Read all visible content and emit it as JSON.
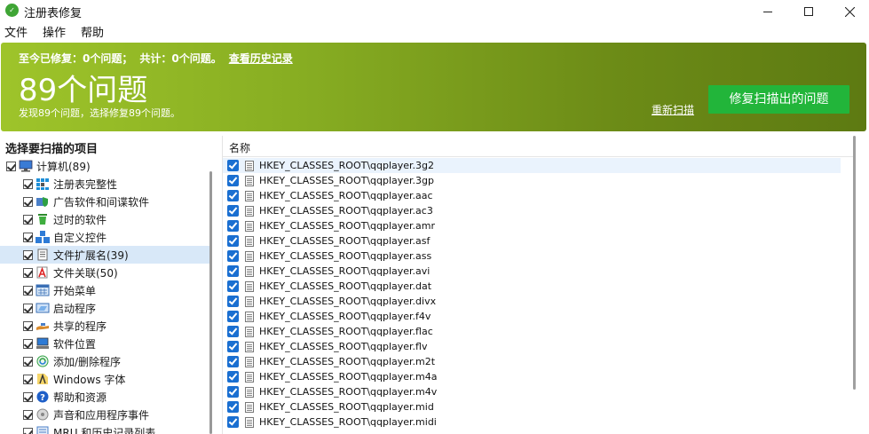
{
  "window": {
    "title": "注册表修复",
    "app_icon": "app-logo-icon"
  },
  "menu": [
    "文件",
    "操作",
    "帮助"
  ],
  "banner": {
    "stats": [
      "至今已修复：0个问题；",
      "共计：0个问题。"
    ],
    "history_link": "查看历史记录",
    "count_title": "89个问题",
    "subtitle": "发现89个问题，选择修复89个问题。",
    "rescan": "重新扫描",
    "fix_button": "修复扫描出的问题",
    "accent_colors": [
      "#9ec42a",
      "#5d7a12"
    ],
    "button_color": "#22b53a"
  },
  "left_panel": {
    "header": "选择要扫描的项目",
    "root": {
      "label": "计算机(89)",
      "icon": "computer-icon"
    },
    "items": [
      {
        "label": "注册表完整性",
        "icon": "registry-icon"
      },
      {
        "label": "广告软件和间谍软件",
        "icon": "shield-icon"
      },
      {
        "label": "过时的软件",
        "icon": "trash-icon"
      },
      {
        "label": "自定义控件",
        "icon": "blocks-icon"
      },
      {
        "label": "文件扩展名(39)",
        "icon": "file-list-icon",
        "selected": true
      },
      {
        "label": "文件关联(50)",
        "icon": "file-a-icon"
      },
      {
        "label": "开始菜单",
        "icon": "menu-grid-icon"
      },
      {
        "label": "启动程序",
        "icon": "window-icon"
      },
      {
        "label": "共享的程序",
        "icon": "share-hand-icon"
      },
      {
        "label": "软件位置",
        "icon": "computer-small-icon"
      },
      {
        "label": "添加/删除程序",
        "icon": "recycle-icon"
      },
      {
        "label": "Windows 字体",
        "icon": "font-icon"
      },
      {
        "label": "帮助和资源",
        "icon": "help-icon"
      },
      {
        "label": "声音和应用程序事件",
        "icon": "sound-icon"
      },
      {
        "label": "MRU 和历史记录列表",
        "icon": "history-icon"
      }
    ]
  },
  "right_panel": {
    "column_header": "名称",
    "rows": [
      "HKEY_CLASSES_ROOT\\qqplayer.3g2",
      "HKEY_CLASSES_ROOT\\qqplayer.3gp",
      "HKEY_CLASSES_ROOT\\qqplayer.aac",
      "HKEY_CLASSES_ROOT\\qqplayer.ac3",
      "HKEY_CLASSES_ROOT\\qqplayer.amr",
      "HKEY_CLASSES_ROOT\\qqplayer.asf",
      "HKEY_CLASSES_ROOT\\qqplayer.ass",
      "HKEY_CLASSES_ROOT\\qqplayer.avi",
      "HKEY_CLASSES_ROOT\\qqplayer.dat",
      "HKEY_CLASSES_ROOT\\qqplayer.divx",
      "HKEY_CLASSES_ROOT\\qqplayer.f4v",
      "HKEY_CLASSES_ROOT\\qqplayer.flac",
      "HKEY_CLASSES_ROOT\\qqplayer.flv",
      "HKEY_CLASSES_ROOT\\qqplayer.m2t",
      "HKEY_CLASSES_ROOT\\qqplayer.m4a",
      "HKEY_CLASSES_ROOT\\qqplayer.m4v",
      "HKEY_CLASSES_ROOT\\qqplayer.mid",
      "HKEY_CLASSES_ROOT\\qqplayer.midi"
    ]
  }
}
